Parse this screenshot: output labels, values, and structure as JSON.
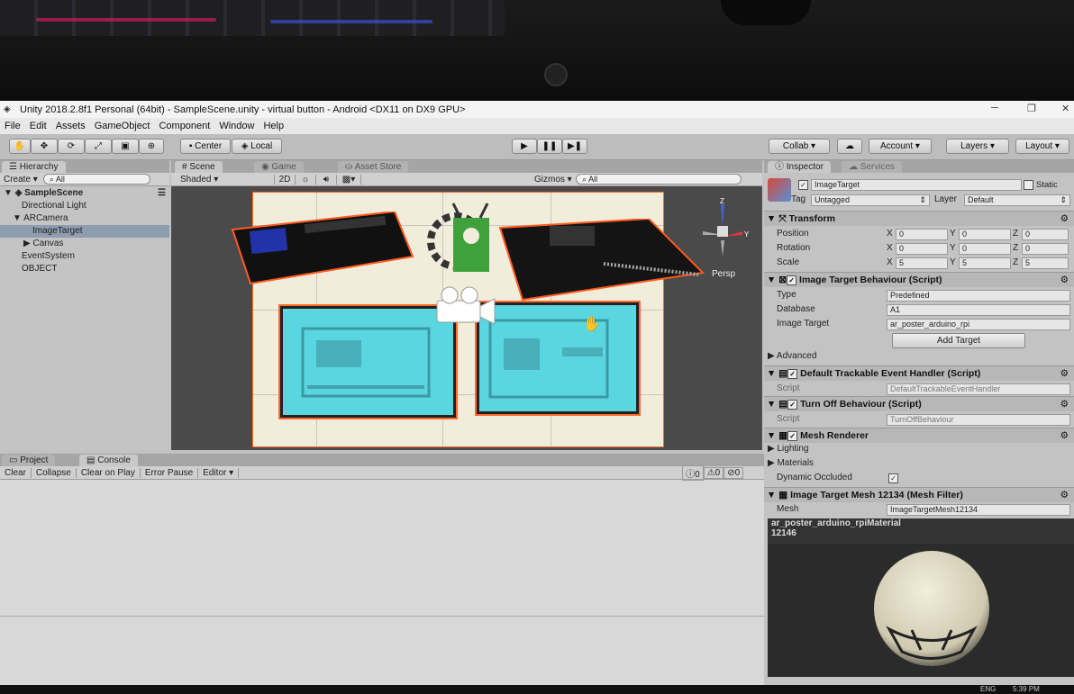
{
  "window": {
    "title": "Unity 2018.2.8f1 Personal (64bit) - SampleScene.unity - virtual button - Android <DX11 on DX9 GPU>",
    "controls": [
      "─",
      "❐",
      "✕"
    ]
  },
  "menubar": [
    "File",
    "Edit",
    "Assets",
    "GameObject",
    "Component",
    "Window",
    "Help"
  ],
  "toolbar": {
    "pivot": "Center",
    "space": "Local",
    "collab": "Collab ▾",
    "account": "Account",
    "layers": "Layers",
    "layout": "Layout"
  },
  "hierarchy": {
    "tab": "Hierarchy",
    "create": "Create ▾",
    "search": "All",
    "items": [
      {
        "label": "SampleScene",
        "bold": true
      },
      {
        "label": "Directional Light"
      },
      {
        "label": "ARCamera"
      },
      {
        "label": "ImageTarget",
        "selected": true
      },
      {
        "label": "Canvas"
      },
      {
        "label": "EventSystem"
      },
      {
        "label": "OBJECT"
      }
    ]
  },
  "scene": {
    "tabs": [
      "Scene",
      "Game",
      "Asset Store"
    ],
    "shading": "Shaded",
    "mode2d": "2D",
    "gizmos": "Gizmos ▾",
    "search": "All",
    "persp": "Persp",
    "axis_y": "Y",
    "axis_z": "Z"
  },
  "console": {
    "tabs": [
      "Project",
      "Console"
    ],
    "buttons": [
      "Clear",
      "Collapse",
      "Clear on Play",
      "Error Pause",
      "Editor ▾"
    ],
    "counts": [
      "0",
      "0",
      "0"
    ]
  },
  "inspector": {
    "tabs": [
      "Inspector",
      "Services"
    ],
    "object_name": "ImageTarget",
    "static_label": "Static",
    "tag_label": "Tag",
    "tag_value": "Untagged",
    "layer_label": "Layer",
    "layer_value": "Default",
    "transform": {
      "header": "Transform",
      "position_label": "Position",
      "rotation_label": "Rotation",
      "scale_label": "Scale",
      "position": [
        "0",
        "0",
        "0"
      ],
      "rotation": [
        "0",
        "0",
        "0"
      ],
      "scale": [
        "5",
        "5",
        "5"
      ]
    },
    "itb": {
      "header": "Image Target Behaviour (Script)",
      "type_label": "Type",
      "type_value": "Predefined",
      "db_label": "Database",
      "db_value": "A1",
      "target_label": "Image Target",
      "target_value": "ar_poster_arduino_rpi",
      "add_target": "Add Target",
      "advanced": "Advanced"
    },
    "dteh": {
      "header": "Default Trackable Event Handler (Script)",
      "script_label": "Script",
      "script_value": "DefaultTrackableEventHandler"
    },
    "tob": {
      "header": "Turn Off Behaviour (Script)",
      "script_label": "Script",
      "script_value": "TurnOffBehaviour"
    },
    "mr": {
      "header": "Mesh Renderer",
      "lighting": "Lighting",
      "materials": "Materials",
      "dynamic": "Dynamic Occluded"
    },
    "mf": {
      "header": "Image Target Mesh 12134 (Mesh Filter)",
      "mesh_label": "Mesh",
      "mesh_value": "ImageTargetMesh12134"
    },
    "preview_title": "ar_poster_arduino_rpiMaterial",
    "preview_sub": "12146"
  },
  "taskbar": {
    "lang": "ENG",
    "time": "5:39 PM"
  }
}
